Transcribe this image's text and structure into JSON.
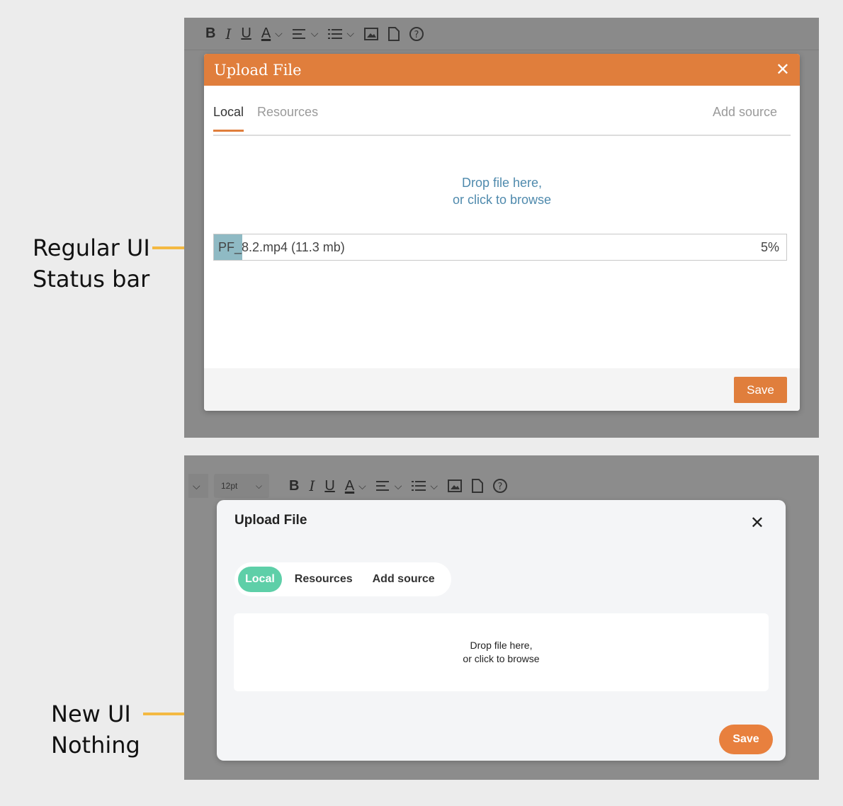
{
  "annotations": {
    "top_line1": "Regular UI",
    "top_line2": "Status bar",
    "bottom_line1": "New UI",
    "bottom_line2": "Nothing",
    "arrow_color": "#f4b942"
  },
  "old_ui": {
    "toolbar": {
      "bold": "B",
      "italic": "I",
      "underline": "U",
      "text_color": "A",
      "icons": [
        "bold-icon",
        "italic-icon",
        "underline-icon",
        "text-color-icon",
        "align-icon",
        "list-icon",
        "image-icon",
        "file-icon",
        "help-icon"
      ]
    },
    "modal": {
      "title": "Upload File",
      "close": "✕",
      "tabs": [
        "Local",
        "Resources"
      ],
      "add_source": "Add source",
      "drop_line1": "Drop file here,",
      "drop_line2": "or click to browse",
      "file_name": "PF_8.2.mp4 (11.3 mb)",
      "file_progress_label": "5%",
      "file_progress": 0.05,
      "save": "Save",
      "accent": "#e07e3c"
    }
  },
  "new_ui": {
    "toolbar": {
      "font_size": "12pt",
      "bold": "B",
      "italic": "I",
      "underline": "U",
      "text_color": "A"
    },
    "modal": {
      "title": "Upload File",
      "close": "✕",
      "tabs": [
        "Local",
        "Resources",
        "Add source"
      ],
      "drop_line1": "Drop file here,",
      "drop_line2": "or click to browse",
      "save": "Save",
      "accent": "#5ecfa8",
      "save_color": "#e8803e"
    }
  }
}
